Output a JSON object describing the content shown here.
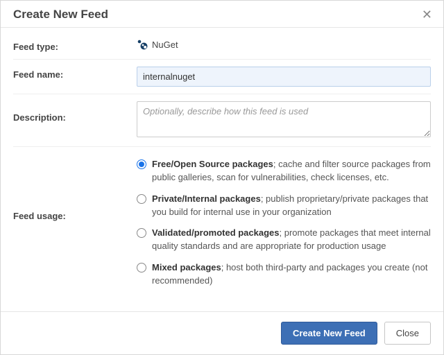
{
  "modal": {
    "title": "Create New Feed",
    "close_glyph": "✕"
  },
  "fields": {
    "feed_type_label": "Feed type:",
    "feed_type_value": "NuGet",
    "feed_name_label": "Feed name:",
    "feed_name_value": "internalnuget",
    "description_label": "Description:",
    "description_placeholder": "Optionally, describe how this feed is used",
    "feed_usage_label": "Feed usage:"
  },
  "usage_options": [
    {
      "checked": true,
      "title": "Free/Open Source packages",
      "desc": "; cache and filter source packages from public galleries, scan for vulnerabilities, check licenses, etc."
    },
    {
      "checked": false,
      "title": "Private/Internal packages",
      "desc": "; publish proprietary/private packages that you build for internal use in your organization"
    },
    {
      "checked": false,
      "title": "Validated/promoted packages",
      "desc": "; promote packages that meet internal quality standards and are appropriate for production usage"
    },
    {
      "checked": false,
      "title": "Mixed packages",
      "desc": "; host both third-party and packages you create (not recommended)"
    }
  ],
  "footer": {
    "primary": "Create New Feed",
    "secondary": "Close"
  }
}
